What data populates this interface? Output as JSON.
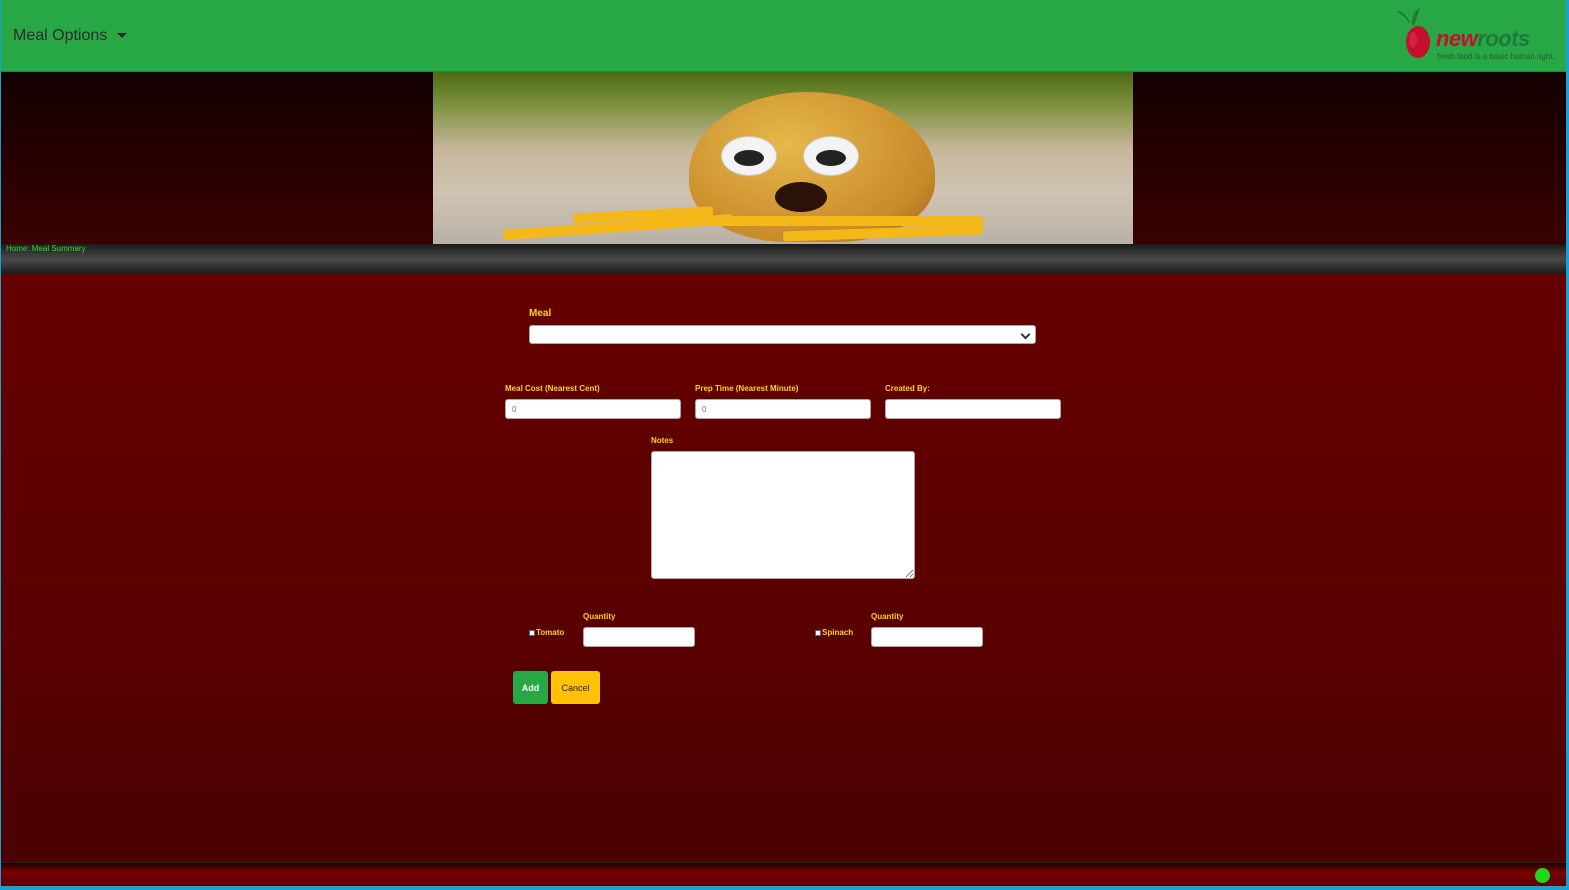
{
  "navbar": {
    "dropdown_label": "Meal Options",
    "logo": {
      "word1": "new",
      "word2": "roots",
      "tagline": "fresh food is a basic human right."
    }
  },
  "breadcrumb": "Home: Meal Summary",
  "form": {
    "meal_label": "Meal",
    "meal_value": "",
    "cost_label": "Meal Cost (Nearest Cent)",
    "cost_value": "0",
    "prep_label": "Prep Time (Nearest Minute)",
    "prep_value": "0",
    "created_by_label": "Created By:",
    "created_by_value": "",
    "notes_label": "Notes",
    "notes_value": "",
    "ingredients": [
      {
        "name": "Tomato",
        "quantity_label": "Quantity",
        "quantity_value": ""
      },
      {
        "name": "Spinach",
        "quantity_label": "Quantity",
        "quantity_value": ""
      }
    ],
    "add_label": "Add",
    "cancel_label": "Cancel"
  },
  "colors": {
    "navbar": "#28a745",
    "label": "#ffd21e",
    "background": "#5a0000",
    "status": "#1ed81e"
  },
  "icons": {
    "dropdown": "caret-down-icon",
    "select": "chevron-down-icon",
    "status": "status-dot-icon"
  }
}
